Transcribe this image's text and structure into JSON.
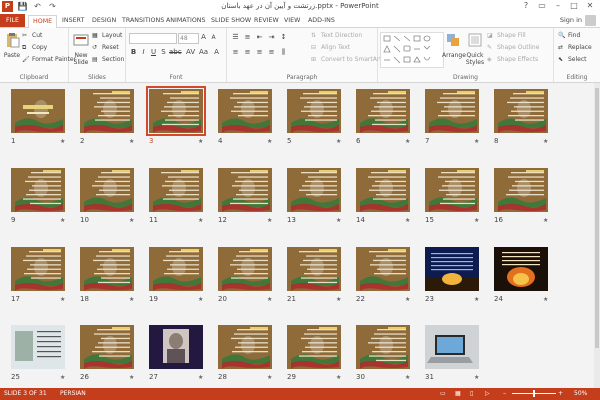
{
  "window": {
    "title": "زرتشت و آیین آن در عهد باستان.pptx - PowerPoint",
    "controls": [
      "?",
      "▭",
      "–",
      "□",
      "✕"
    ]
  },
  "qat": {
    "app_icon": "P",
    "save": "💾",
    "undo": "↶",
    "redo": "↷"
  },
  "tabs": [
    {
      "label": "FILE"
    },
    {
      "label": "HOME"
    },
    {
      "label": "INSERT"
    },
    {
      "label": "DESIGN"
    },
    {
      "label": "TRANSITIONS"
    },
    {
      "label": "ANIMATIONS"
    },
    {
      "label": "SLIDE SHOW"
    },
    {
      "label": "REVIEW"
    },
    {
      "label": "VIEW"
    },
    {
      "label": "ADD-INS"
    }
  ],
  "account": {
    "signin": "Sign in"
  },
  "ribbon": {
    "clipboard": {
      "label": "Clipboard",
      "paste": "Paste",
      "cut": "Cut",
      "copy": "Copy",
      "format_painter": "Format Painter"
    },
    "slides": {
      "label": "Slides",
      "new_slide": "New Slide",
      "layout": "Layout",
      "reset": "Reset",
      "section": "Section"
    },
    "font": {
      "label": "Font",
      "size": "48"
    },
    "paragraph": {
      "label": "Paragraph",
      "text_direction": "Text Direction",
      "align_text": "Align Text",
      "convert": "Convert to SmartArt"
    },
    "drawing": {
      "label": "Drawing",
      "arrange": "Arrange",
      "quick_styles": "Quick Styles",
      "shape_fill": "Shape Fill",
      "shape_outline": "Shape Outline",
      "shape_effects": "Shape Effects"
    },
    "editing": {
      "label": "Editing",
      "find": "Find",
      "replace": "Replace",
      "select": "Select"
    }
  },
  "slides": [
    {
      "n": "1",
      "kind": "title"
    },
    {
      "n": "2",
      "kind": "text"
    },
    {
      "n": "3",
      "kind": "text"
    },
    {
      "n": "4",
      "kind": "text"
    },
    {
      "n": "5",
      "kind": "text"
    },
    {
      "n": "6",
      "kind": "text"
    },
    {
      "n": "7",
      "kind": "text"
    },
    {
      "n": "8",
      "kind": "text"
    },
    {
      "n": "9",
      "kind": "text"
    },
    {
      "n": "10",
      "kind": "text"
    },
    {
      "n": "11",
      "kind": "text"
    },
    {
      "n": "12",
      "kind": "text"
    },
    {
      "n": "13",
      "kind": "text"
    },
    {
      "n": "14",
      "kind": "text"
    },
    {
      "n": "15",
      "kind": "text"
    },
    {
      "n": "16",
      "kind": "text"
    },
    {
      "n": "17",
      "kind": "text"
    },
    {
      "n": "18",
      "kind": "text"
    },
    {
      "n": "19",
      "kind": "text"
    },
    {
      "n": "20",
      "kind": "text"
    },
    {
      "n": "21",
      "kind": "text"
    },
    {
      "n": "22",
      "kind": "text"
    },
    {
      "n": "23",
      "kind": "night"
    },
    {
      "n": "24",
      "kind": "fire"
    },
    {
      "n": "25",
      "kind": "light"
    },
    {
      "n": "26",
      "kind": "text"
    },
    {
      "n": "27",
      "kind": "portrait"
    },
    {
      "n": "28",
      "kind": "text"
    },
    {
      "n": "29",
      "kind": "text"
    },
    {
      "n": "30",
      "kind": "text"
    },
    {
      "n": "31",
      "kind": "laptop"
    }
  ],
  "selected_slide": "3",
  "status": {
    "slide_info": "SLIDE 3 OF 31",
    "language": "PERSIAN",
    "zoom": "50%"
  },
  "colors": {
    "accent": "#c43e1c",
    "selection": "#d4482c",
    "slide_bg": "#8a6b3a"
  }
}
